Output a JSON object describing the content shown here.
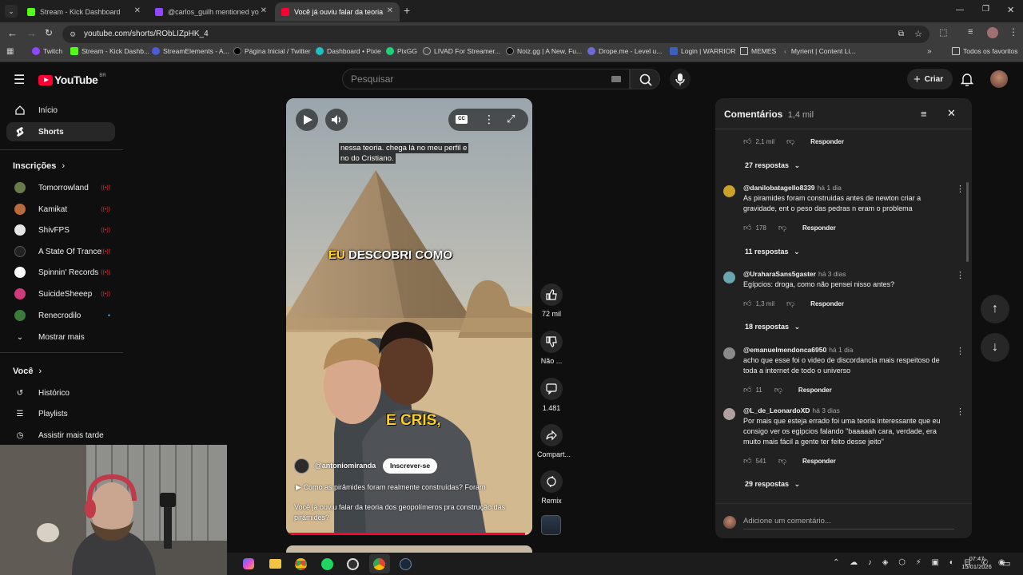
{
  "browser": {
    "tabs": [
      {
        "title": "Stream - Kick Dashboard",
        "color": "#53fc18"
      },
      {
        "title": "@carlos_guilh mentioned yo",
        "color": "#9146ff"
      },
      {
        "title": "Você já ouviu falar da teoria d",
        "color": "#ff0033"
      }
    ],
    "new_tab": "+",
    "url": "youtube.com/shorts/RObLIZpHK_4",
    "bookmarks": [
      "Twitch",
      "Stream - Kick Dashb...",
      "StreamElements - A...",
      "Página Inicial / Twitter",
      "Dashboard • Pixie",
      "PixGG",
      "LIVAD For Streamer...",
      "Noiz.gg | A New, Fu...",
      "Drope.me - Level u...",
      "Login | WARRIOR",
      "MEMES",
      "Myrient | Content Li..."
    ],
    "all_bookmarks": "Todos os favoritos"
  },
  "youtube": {
    "logo": "YouTube",
    "country": "BR",
    "search_placeholder": "Pesquisar",
    "create_label": "Criar"
  },
  "sidebar": {
    "main": [
      {
        "label": "Início",
        "icon": "home-icon"
      },
      {
        "label": "Shorts",
        "icon": "shorts-icon"
      }
    ],
    "subs_header": "Inscrições",
    "subs": [
      {
        "label": "Tomorrowland",
        "color": "#6a7b4a",
        "live": true
      },
      {
        "label": "Kamikat",
        "color": "#b86a3a",
        "live": true
      },
      {
        "label": "ShivFPS",
        "color": "#e6e6e6",
        "live": true
      },
      {
        "label": "A State Of Trance",
        "color": "#222222",
        "live": true
      },
      {
        "label": "Spinnin' Records",
        "color": "#ffffff",
        "live": true
      },
      {
        "label": "SuicideSheeep",
        "color": "#d03a7a",
        "live": true
      },
      {
        "label": "Renecrodilo",
        "color": "#3a7a3a",
        "live": false
      }
    ],
    "show_more": "Mostrar mais",
    "you_header": "Você",
    "you": [
      {
        "label": "Histórico",
        "icon": "history-icon"
      },
      {
        "label": "Playlists",
        "icon": "playlists-icon"
      },
      {
        "label": "Assistir mais tarde",
        "icon": "watch-later-icon"
      }
    ]
  },
  "video": {
    "caption_line1": "nessa teoria. chega lá no meu perfil e",
    "caption_line2": "no do Cristiano.",
    "overlay_text_1": "EU",
    "overlay_text_2": "DESCOBRI COMO",
    "overlay_text_3": "E CRIS,",
    "channel": "@antoniomiranda",
    "subscribe": "Inscrever-se",
    "playlist_title": "Como as pirâmides foram realmente construídas? Foram",
    "description": "Você já ouviu falar da teoria dos geopolímeros pra construção das pirâmides?",
    "progress": 0.97
  },
  "actions": {
    "likes": "72 mil",
    "dislike": "Não ...",
    "comments": "1.481",
    "share": "Compart...",
    "remix": "Remix"
  },
  "comments_panel": {
    "title": "Comentários",
    "count": "1,4 mil",
    "reply": "Responder",
    "add_placeholder": "Adicione um comentário...",
    "top_likes": "2,1 mil",
    "top_replies": "27 respostas",
    "items": [
      {
        "author": "@danilobatagello8339",
        "time": "há 1 dia",
        "text": "As piramides foram construidas antes de newton criar a gravidade, ent o peso das pedras n eram o problema",
        "likes": "178",
        "replies": "11 respostas",
        "color": "#c9a227"
      },
      {
        "author": "@UraharaSans5gaster",
        "time": "há 3 dias",
        "text": "Egípcios: droga, como não pensei nisso antes?",
        "likes": "1,3 mil",
        "replies": "18 respostas",
        "color": "#6aa6b0"
      },
      {
        "author": "@emanuelmendonca6950",
        "time": "há 1 dia",
        "text": "acho que esse foi o video de discordancia mais respeitoso de toda a internet de todo o universo",
        "likes": "11",
        "replies": "",
        "color": "#8a8a8a"
      },
      {
        "author": "@L_de_LeonardoXD",
        "time": "há 3 dias",
        "text": "Por mais que esteja errado foi uma teoria interessante que eu consigo ver os egipcios falando \"baaaaah cara, verdade, era muito mais fácil a gente ter feito desse jeito\"",
        "likes": "541",
        "replies": "29 respostas",
        "color": "#b0a0a0"
      }
    ]
  },
  "taskbar": {
    "time": "07:47",
    "date": "15/01/2026"
  }
}
